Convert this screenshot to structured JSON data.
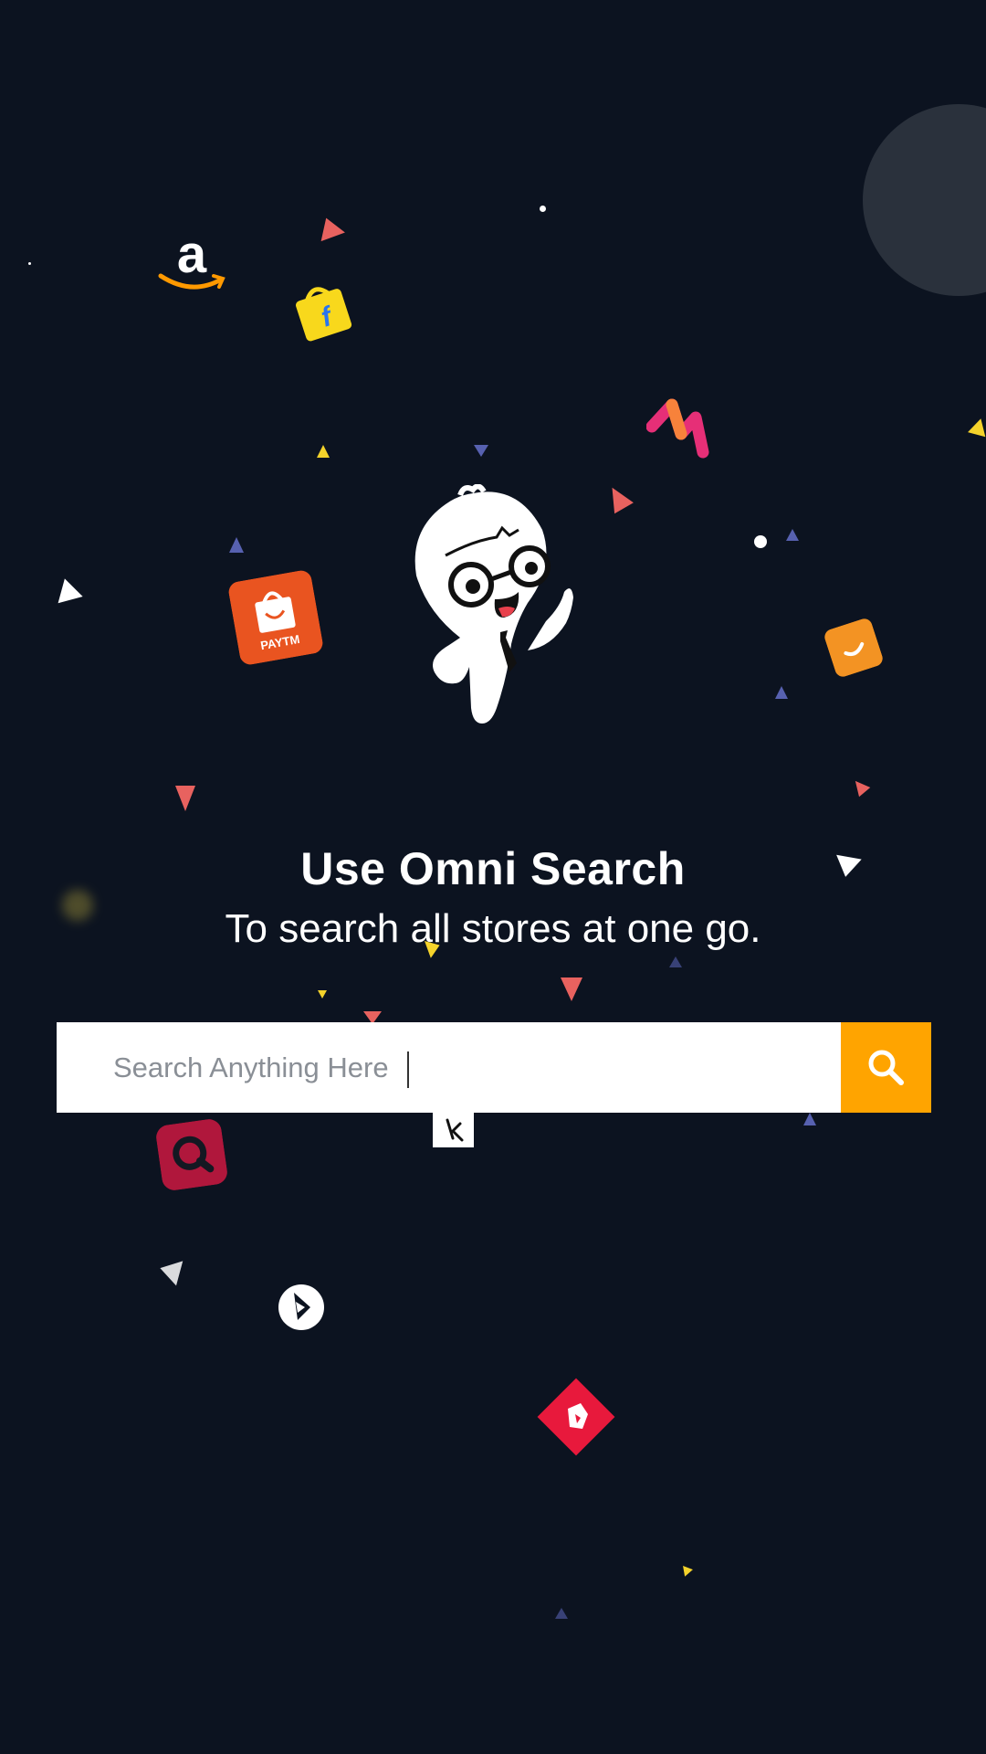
{
  "hero": {
    "title": "Use Omni Search",
    "subtitle": "To search all stores at one go."
  },
  "search": {
    "placeholder": "Search Anything Here",
    "button_icon": "search-icon",
    "button_color": "#ffa400"
  },
  "mascot": {
    "icon": "mascot-character"
  },
  "store_logos": [
    {
      "name": "amazon",
      "icon": "amazon-logo",
      "color": "#ff9900"
    },
    {
      "name": "flipkart",
      "icon": "flipkart-logo",
      "color": "#f8d81c"
    },
    {
      "name": "myntra",
      "icon": "myntra-logo",
      "color": "#e62f77"
    },
    {
      "name": "paytm",
      "icon": "paytm-mall-logo",
      "label": "PAYTM",
      "color": "#e95420"
    },
    {
      "name": "orange-store",
      "icon": "orange-bag-logo",
      "color": "#f39323"
    },
    {
      "name": "search-app",
      "icon": "magnifier-logo",
      "color": "#b0173c"
    },
    {
      "name": "k-store",
      "icon": "k-logo",
      "color": "#ffffff"
    },
    {
      "name": "dealshare",
      "icon": "arrow-circle-logo",
      "color": "#ffffff"
    },
    {
      "name": "shopclues",
      "icon": "red-diamond-logo",
      "color": "#e8193c"
    }
  ],
  "theme": {
    "background": "#0c1320",
    "accent": "#ffa400"
  }
}
